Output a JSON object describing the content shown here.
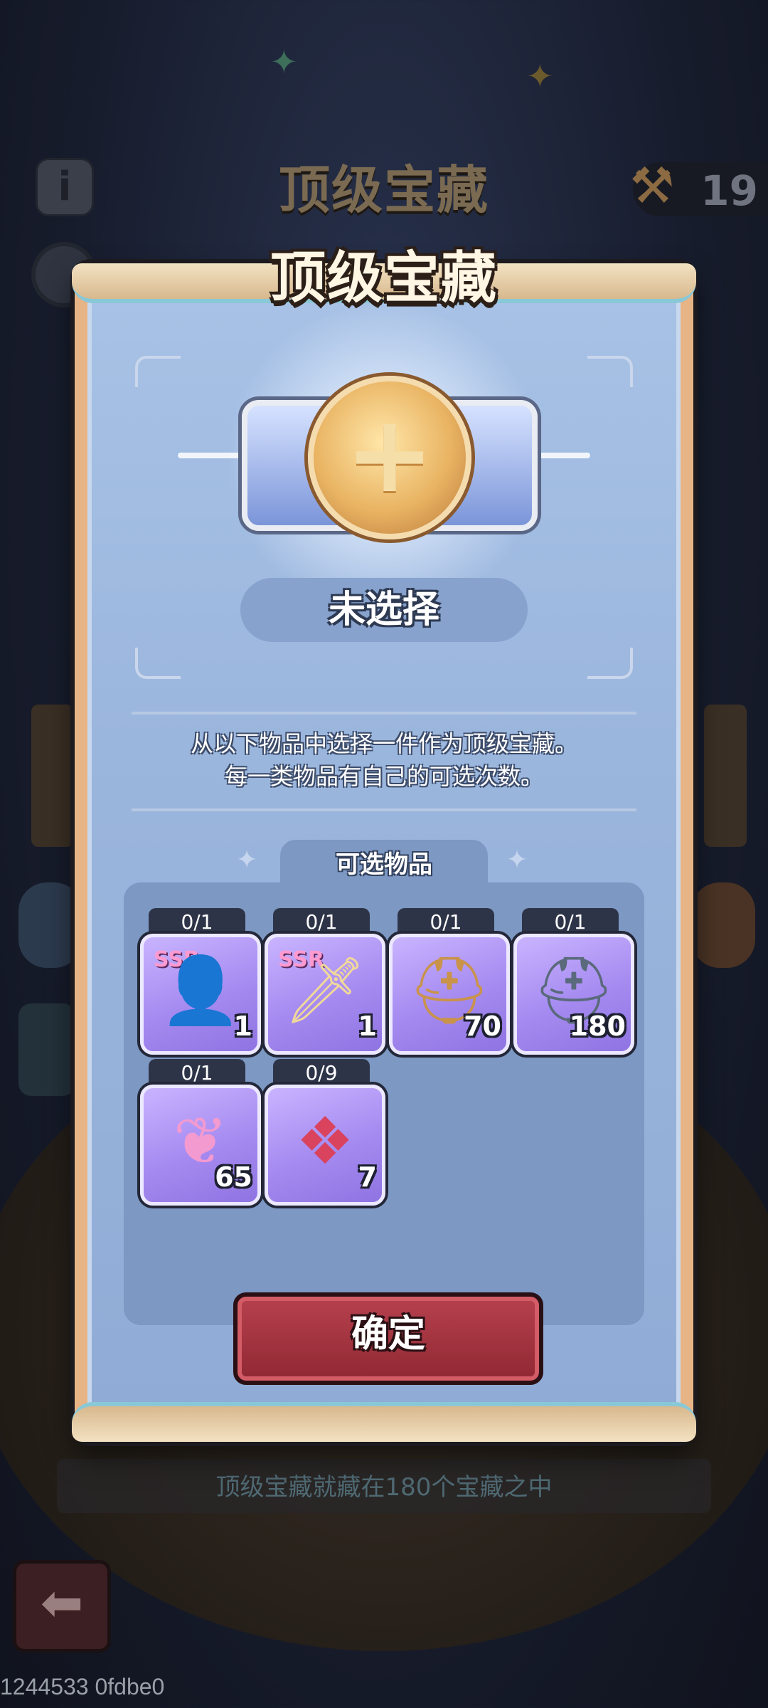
{
  "background": {
    "title": "顶级宝藏",
    "counter_value": "19",
    "hint": "顶级宝藏就藏在180个宝藏之中"
  },
  "dialog": {
    "title": "顶级宝藏",
    "selection_status": "未选择",
    "description_line1": "从以下物品中选择一件作为顶级宝藏。",
    "description_line2": "每一类物品有自己的可选次数。",
    "panel_title": "可选物品",
    "confirm_label": "确定"
  },
  "items": [
    {
      "icon": "ssr-hero-selector-icon",
      "badge": "SSR",
      "limit": "0/1",
      "qty": "1"
    },
    {
      "icon": "ssr-weapon-selector-icon",
      "badge": "SSR",
      "limit": "0/1",
      "qty": "1"
    },
    {
      "icon": "gold-helmet-book-icon",
      "limit": "0/1",
      "qty": "70"
    },
    {
      "icon": "iron-helmet-book-icon",
      "limit": "0/1",
      "qty": "180"
    },
    {
      "icon": "pink-crystal-icon",
      "limit": "0/1",
      "qty": "65"
    },
    {
      "icon": "red-gem-emblem-icon",
      "limit": "0/9",
      "qty": "7"
    }
  ],
  "debug_text": "1244533 0fdbe0"
}
